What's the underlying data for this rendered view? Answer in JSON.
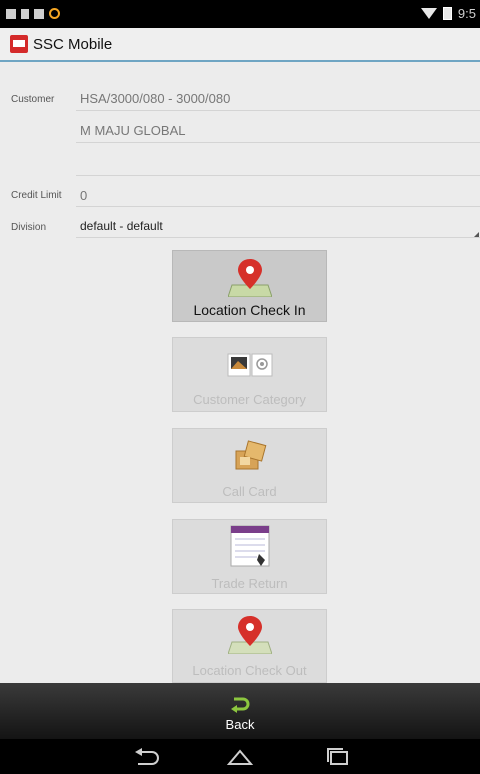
{
  "status_bar": {
    "time": "9:5"
  },
  "app": {
    "title": "SSC Mobile"
  },
  "form": {
    "customer_label": "Customer",
    "customer_code": "HSA/3000/080 - 3000/080",
    "customer_name": "M MAJU GLOBAL",
    "credit_limit_label": "Credit Limit",
    "credit_limit_value": "0",
    "division_label": "Division",
    "division_value": "default - default"
  },
  "buttons": [
    {
      "label": "Location Check In",
      "icon": "map-pin-icon",
      "enabled": true
    },
    {
      "label": "Customer Category",
      "icon": "customer-category-icon",
      "enabled": false
    },
    {
      "label": "Call Card",
      "icon": "call-card-icon",
      "enabled": false
    },
    {
      "label": "Trade Return",
      "icon": "trade-return-icon",
      "enabled": false
    },
    {
      "label": "Location Check Out",
      "icon": "map-pin-icon",
      "enabled": false
    }
  ],
  "bottom": {
    "back_label": "Back"
  },
  "colors": {
    "accent": "#6fa5c3",
    "pin_red": "#d6302a",
    "back_green": "#8cc63f"
  }
}
